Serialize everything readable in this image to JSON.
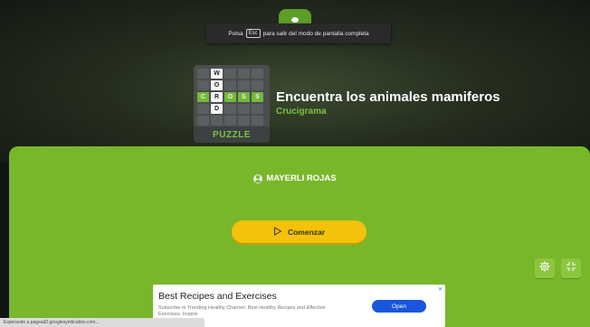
{
  "fullscreen_toast": {
    "prefix": "Pulsa",
    "key": "Esc",
    "suffix": "para salir del modo de pantalla completa"
  },
  "logo": {
    "rows": [
      [
        "",
        "W",
        "",
        "",
        ""
      ],
      [
        "",
        "O",
        "",
        "",
        ""
      ],
      [
        "C",
        "R",
        "O",
        "S",
        "S"
      ],
      [
        "",
        "D",
        "",
        "",
        ""
      ]
    ],
    "word": "PUZZLE"
  },
  "game": {
    "title": "Encuentra los animales mamiferos",
    "type": "Crucigrama"
  },
  "player": {
    "name": "MAYERLI ROJAS",
    "icon": "user-circle-icon"
  },
  "start_button": {
    "label": "Comenzar",
    "icon": "play-icon"
  },
  "controls": {
    "settings_icon": "gear-icon",
    "fullscreen_icon": "exit-fullscreen-icon"
  },
  "ad": {
    "title": "Best Recipes and Exercises",
    "text": "Subscribe to Trending Healthy Channel. Best Healthy Recipes and Effective Exercises. Inspire",
    "button": "Open",
    "close": "✕"
  },
  "status_bar": {
    "text": "Esperando a pagead2.googlesyndication.com..."
  },
  "colors": {
    "accent_green": "#78b72a",
    "button_yellow": "#f2c20d",
    "title_green": "#7cc13d"
  }
}
